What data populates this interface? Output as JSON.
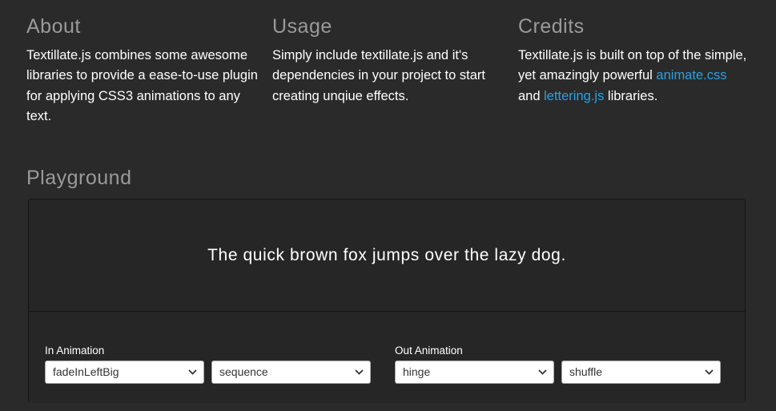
{
  "about": {
    "title": "About",
    "text": "Textillate.js combines some awesome libraries to provide a ease-to-use plugin for applying CSS3 animations to any text."
  },
  "usage": {
    "title": "Usage",
    "text": "Simply include textillate.js and it's dependencies in your project to start creating unqiue effects."
  },
  "credits": {
    "title": "Credits",
    "text_before": "Textillate.js is built on top of the simple, yet amazingly powerful",
    "link1": "animate.css",
    "and": "and",
    "link2": "lettering.js",
    "text_after": "libraries."
  },
  "playground": {
    "title": "Playground",
    "sample_text": "The quick brown fox jumps over the lazy dog.",
    "in_animation": {
      "label": "In Animation",
      "effect": "fadeInLeftBig",
      "type": "sequence"
    },
    "out_animation": {
      "label": "Out Animation",
      "effect": "hinge",
      "type": "shuffle"
    }
  },
  "colors": {
    "background": "#2a2a2a",
    "heading": "#9a9a9a",
    "link": "#2ba0e0"
  },
  "icons": {
    "select_arrow": "chevron-down-icon"
  }
}
